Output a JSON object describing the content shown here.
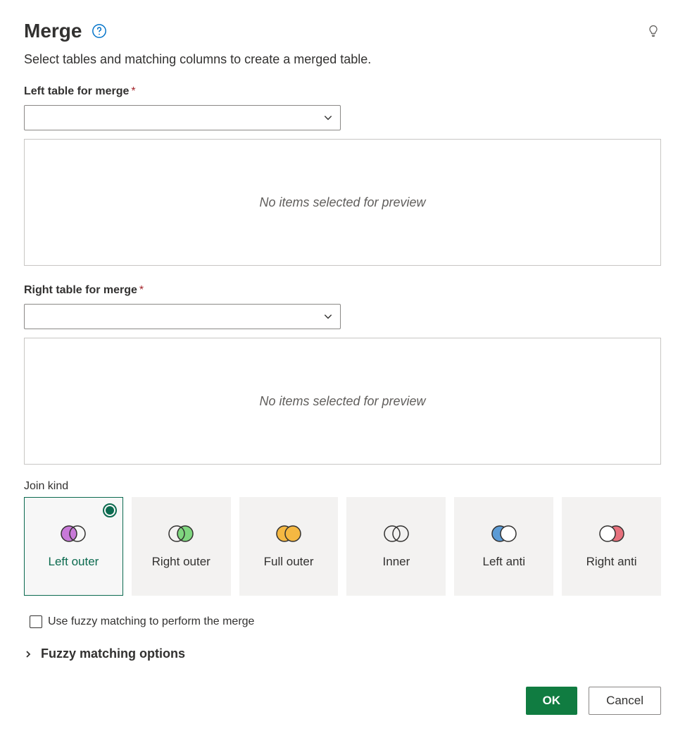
{
  "header": {
    "title": "Merge",
    "subtitle": "Select tables and matching columns to create a merged table."
  },
  "leftTable": {
    "label": "Left table for merge",
    "value": "",
    "previewPlaceholder": "No items selected for preview"
  },
  "rightTable": {
    "label": "Right table for merge",
    "value": "",
    "previewPlaceholder": "No items selected for preview"
  },
  "joinKind": {
    "label": "Join kind",
    "selected": "left-outer",
    "options": {
      "leftOuter": "Left outer",
      "rightOuter": "Right outer",
      "fullOuter": "Full outer",
      "inner": "Inner",
      "leftAnti": "Left anti",
      "rightAnti": "Right anti"
    }
  },
  "fuzzy": {
    "checkboxLabel": "Use fuzzy matching to perform the merge",
    "checked": false,
    "expanderLabel": "Fuzzy matching options",
    "expanded": false
  },
  "footer": {
    "ok": "OK",
    "cancel": "Cancel"
  }
}
